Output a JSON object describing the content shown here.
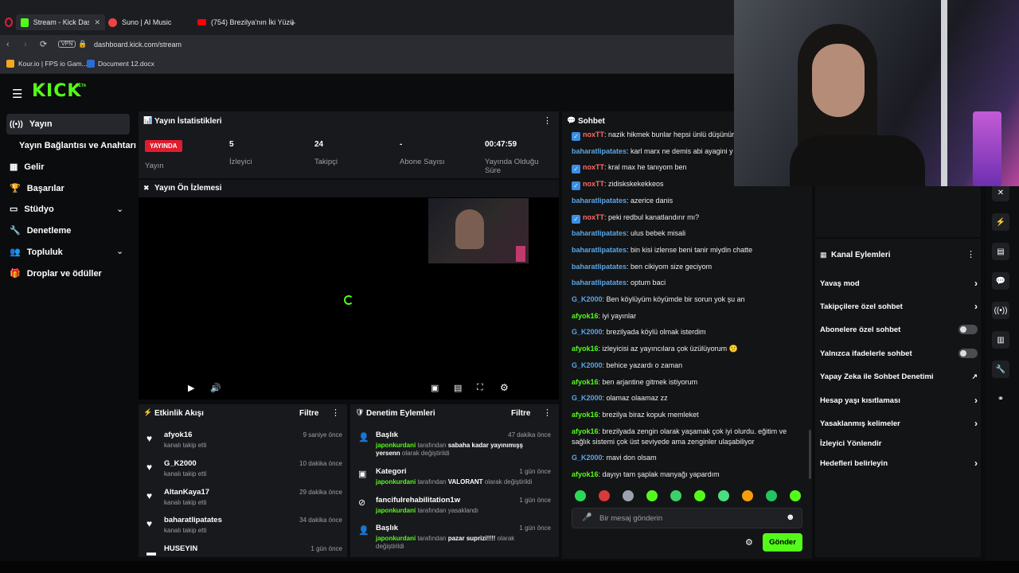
{
  "browser": {
    "tabs": [
      {
        "label": "Stream - Kick Dashbo",
        "active": true
      },
      {
        "label": "Suno | AI Music",
        "active": false
      },
      {
        "label": "(754) Brezilya'nın İki Yüzü",
        "active": false
      }
    ],
    "url": "dashboard.kick.com/stream",
    "vpn": "VPN",
    "bookmarks": [
      "Kour.io | FPS io Gam...",
      "Document 12.docx"
    ]
  },
  "brand": {
    "logo": "KICK",
    "beta": "BETA",
    "accent": "#53fc18"
  },
  "sidebar": {
    "items": [
      {
        "label": "Yayın",
        "icon": "broadcast-icon"
      },
      {
        "label": "Yayın Bağlantısı ve Anahtarı",
        "icon": ""
      },
      {
        "label": "Gelir",
        "icon": "chart-icon"
      },
      {
        "label": "Başarılar",
        "icon": "trophy-icon"
      },
      {
        "label": "Stüdyo",
        "icon": "studio-icon"
      },
      {
        "label": "Denetleme",
        "icon": "wrench-icon"
      },
      {
        "label": "Topluluk",
        "icon": "users-icon"
      },
      {
        "label": "Droplar ve ödüller",
        "icon": "gift-icon"
      }
    ]
  },
  "stats": {
    "title": "Yayın İstatistikleri",
    "live_badge": "YAYINDA",
    "live_label": "Yayın",
    "items": [
      {
        "value": "5",
        "label": "İzleyici"
      },
      {
        "value": "24",
        "label": "Takipçi"
      },
      {
        "value": "-",
        "label": "Abone Sayısı"
      },
      {
        "value": "00:47:59",
        "label": "Yayında Olduğu Süre"
      }
    ]
  },
  "preview": {
    "title": "Yayın Ön İzlemesi"
  },
  "activity": {
    "title": "Etkinlik Akışı",
    "filter": "Filtre",
    "items": [
      {
        "user": "afyok16",
        "action": "kanalı takip etti",
        "time": "9 saniye önce"
      },
      {
        "user": "G_K2000",
        "action": "kanalı takip etti",
        "time": "10 dakika önce"
      },
      {
        "user": "AltanKaya17",
        "action": "kanalı takip etti",
        "time": "29 dakika önce"
      },
      {
        "user": "baharatlipatates",
        "action": "kanalı takip etti",
        "time": "34 dakika önce"
      },
      {
        "user": "HUSEYIN",
        "action": "",
        "time": "1 gün önce"
      }
    ]
  },
  "moderation": {
    "title": "Denetim Eylemleri",
    "filter": "Filtre",
    "items": [
      {
        "title": "Başlık",
        "time": "47 dakika önce",
        "mod": "japonkurdani",
        "mid": " tarafından ",
        "value": "sabaha kadar yayınımışş yersenn",
        "suffix": " olarak değiştirildi"
      },
      {
        "title": "Kategori",
        "time": "1 gün önce",
        "mod": "japonkurdani",
        "mid": " tarafından ",
        "value": "VALORANT",
        "suffix": " olarak değiştirildi"
      },
      {
        "title": "fancifulrehabilitation1w",
        "time": "1 gün önce",
        "mod": "japonkurdani",
        "mid": " tarafından yasaklandı",
        "value": "",
        "suffix": ""
      },
      {
        "title": "Başlık",
        "time": "1 gün önce",
        "mod": "japonkurdani",
        "mid": " tarafından ",
        "value": "pazar suprizi!!!!",
        "suffix": " olarak değiştirildi"
      }
    ]
  },
  "chat": {
    "title": "Sohbet",
    "messages": [
      {
        "user": "noxTT",
        "badge": true,
        "text": "nazik hikmek bunlar hepsi ünlü düşünür"
      },
      {
        "user": "baharatlipatates",
        "badge": false,
        "text": "karl marx ne demis abi ayagini y"
      },
      {
        "user": "noxTT",
        "badge": true,
        "text": "kral max he tanıyom ben"
      },
      {
        "user": "noxTT",
        "badge": true,
        "text": "zidiskskekekkeos"
      },
      {
        "user": "baharatlipatates",
        "badge": false,
        "text": "azerice danis"
      },
      {
        "user": "noxTT",
        "badge": true,
        "text": "peki redbul kanatlandırır mı?"
      },
      {
        "user": "baharatlipatates",
        "badge": false,
        "text": "ulus bebek misali"
      },
      {
        "user": "baharatlipatates",
        "badge": false,
        "text": "bin kisi izlense beni tanir miydin chatte"
      },
      {
        "user": "baharatlipatates",
        "badge": false,
        "text": "ben cikiyom size geciyom"
      },
      {
        "user": "baharatlipatates",
        "badge": false,
        "text": "optum baci"
      },
      {
        "user": "G_K2000",
        "badge": false,
        "text": "Ben köylüyüm köyümde bir sorun yok şu an"
      },
      {
        "user": "afyok16",
        "badge": false,
        "text": "iyi yayınlar"
      },
      {
        "user": "G_K2000",
        "badge": false,
        "text": "brezilyada köylü olmak isterdim"
      },
      {
        "user": "afyok16",
        "badge": false,
        "text": "izleyicisi az yayıncılara çok üzülüyorum 🙁"
      },
      {
        "user": "G_K2000",
        "badge": false,
        "text": "behice yazardı o zaman"
      },
      {
        "user": "afyok16",
        "badge": false,
        "text": "ben arjantine gitmek istiyorum"
      },
      {
        "user": "G_K2000",
        "badge": false,
        "text": "olamaz olaamaz zz"
      },
      {
        "user": "afyok16",
        "badge": false,
        "text": "brezilya biraz kopuk memleket"
      },
      {
        "user": "afyok16",
        "badge": false,
        "text": "brezilyada zengin olarak yaşamak çok iyi olurdu. eğitim ve"
      },
      {
        "user": "",
        "badge": false,
        "text": "sağlık sistemi çok üst seviyede ama zenginler ulaşabiliyor"
      },
      {
        "user": "G_K2000",
        "badge": false,
        "text": "mavi don olsam"
      },
      {
        "user": "afyok16",
        "badge": false,
        "text": "dayıyı tam şaplak manyağı yapardım"
      }
    ],
    "placeholder": "Bir mesaj gönderin",
    "send": "Gönder"
  },
  "channel_actions": {
    "title": "Kanal Eylemleri",
    "items": [
      {
        "label": "Yavaş mod",
        "control": "chevron"
      },
      {
        "label": "Takipçilere özel sohbet",
        "control": "chevron"
      },
      {
        "label": "Abonelere özel sohbet",
        "control": "toggle"
      },
      {
        "label": "Yalnızca ifadelerle sohbet",
        "control": "toggle"
      },
      {
        "label": "Yapay Zeka ile Sohbet Denetimi",
        "control": "external"
      },
      {
        "label": "Hesap yaşı kısıtlaması",
        "control": "chevron"
      },
      {
        "label": "Yasaklanmış kelimeler",
        "control": "chevron"
      },
      {
        "label": "İzleyici Yönlendir",
        "control": "none"
      },
      {
        "label": "Hedefleri belirleyin",
        "control": "chevron"
      }
    ]
  }
}
